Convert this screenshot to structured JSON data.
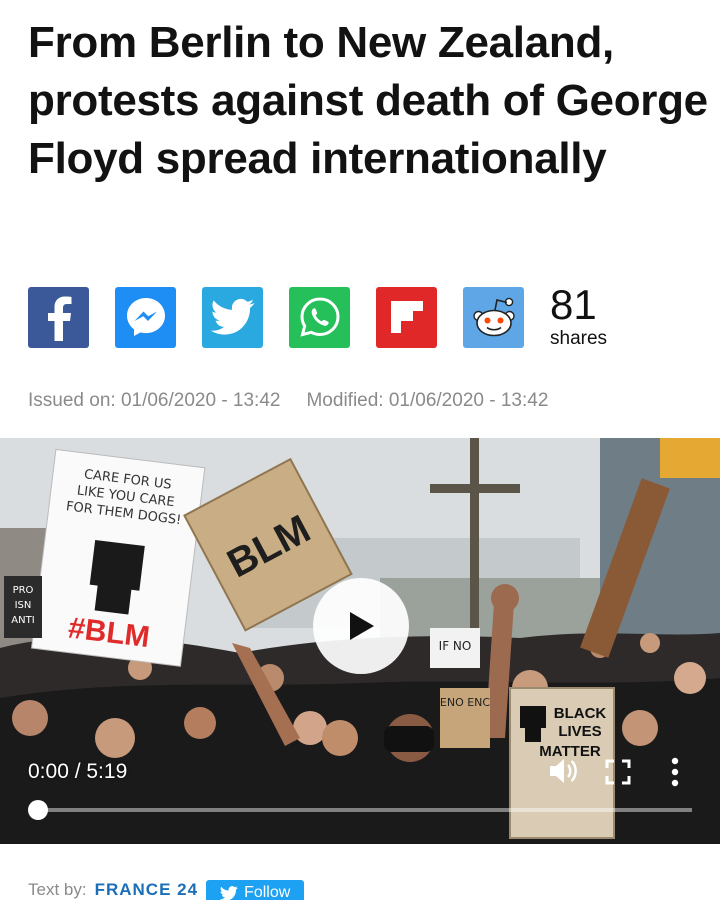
{
  "article": {
    "headline": "From Berlin to New Zealand, protests against death of George Floyd spread internationally",
    "issued": "Issued on: 01/06/2020 - 13:42",
    "modified": "Modified: 01/06/2020 - 13:42"
  },
  "share": {
    "buttons": [
      {
        "name": "facebook",
        "icon": "facebook-icon",
        "color": "#3b5998"
      },
      {
        "name": "messenger",
        "icon": "messenger-icon",
        "color": "#1e8ef5"
      },
      {
        "name": "twitter",
        "icon": "twitter-icon",
        "color": "#2aa9e0"
      },
      {
        "name": "whatsapp",
        "icon": "whatsapp-icon",
        "color": "#25c05a"
      },
      {
        "name": "flipboard",
        "icon": "flipboard-icon",
        "color": "#e12828"
      },
      {
        "name": "reddit",
        "icon": "reddit-icon",
        "color": "#5ea6e6"
      }
    ],
    "count": "81",
    "count_label": "shares"
  },
  "video": {
    "time": "0:00 / 5:19",
    "progress": 0,
    "signs": {
      "care": "CARE FOR US LIKE YOU CARE FOR THEM DOGS!",
      "hashtag": "#BLM",
      "blm": "BLM",
      "black_lives_matter": "BLACK LIVES MATTER",
      "pro": "PRO ISN ANTI",
      "if_no": "IF NO",
      "eno": "ENO ENC"
    }
  },
  "author": {
    "by": "Text by:",
    "name": "FRANCE 24",
    "follow": "Follow"
  }
}
